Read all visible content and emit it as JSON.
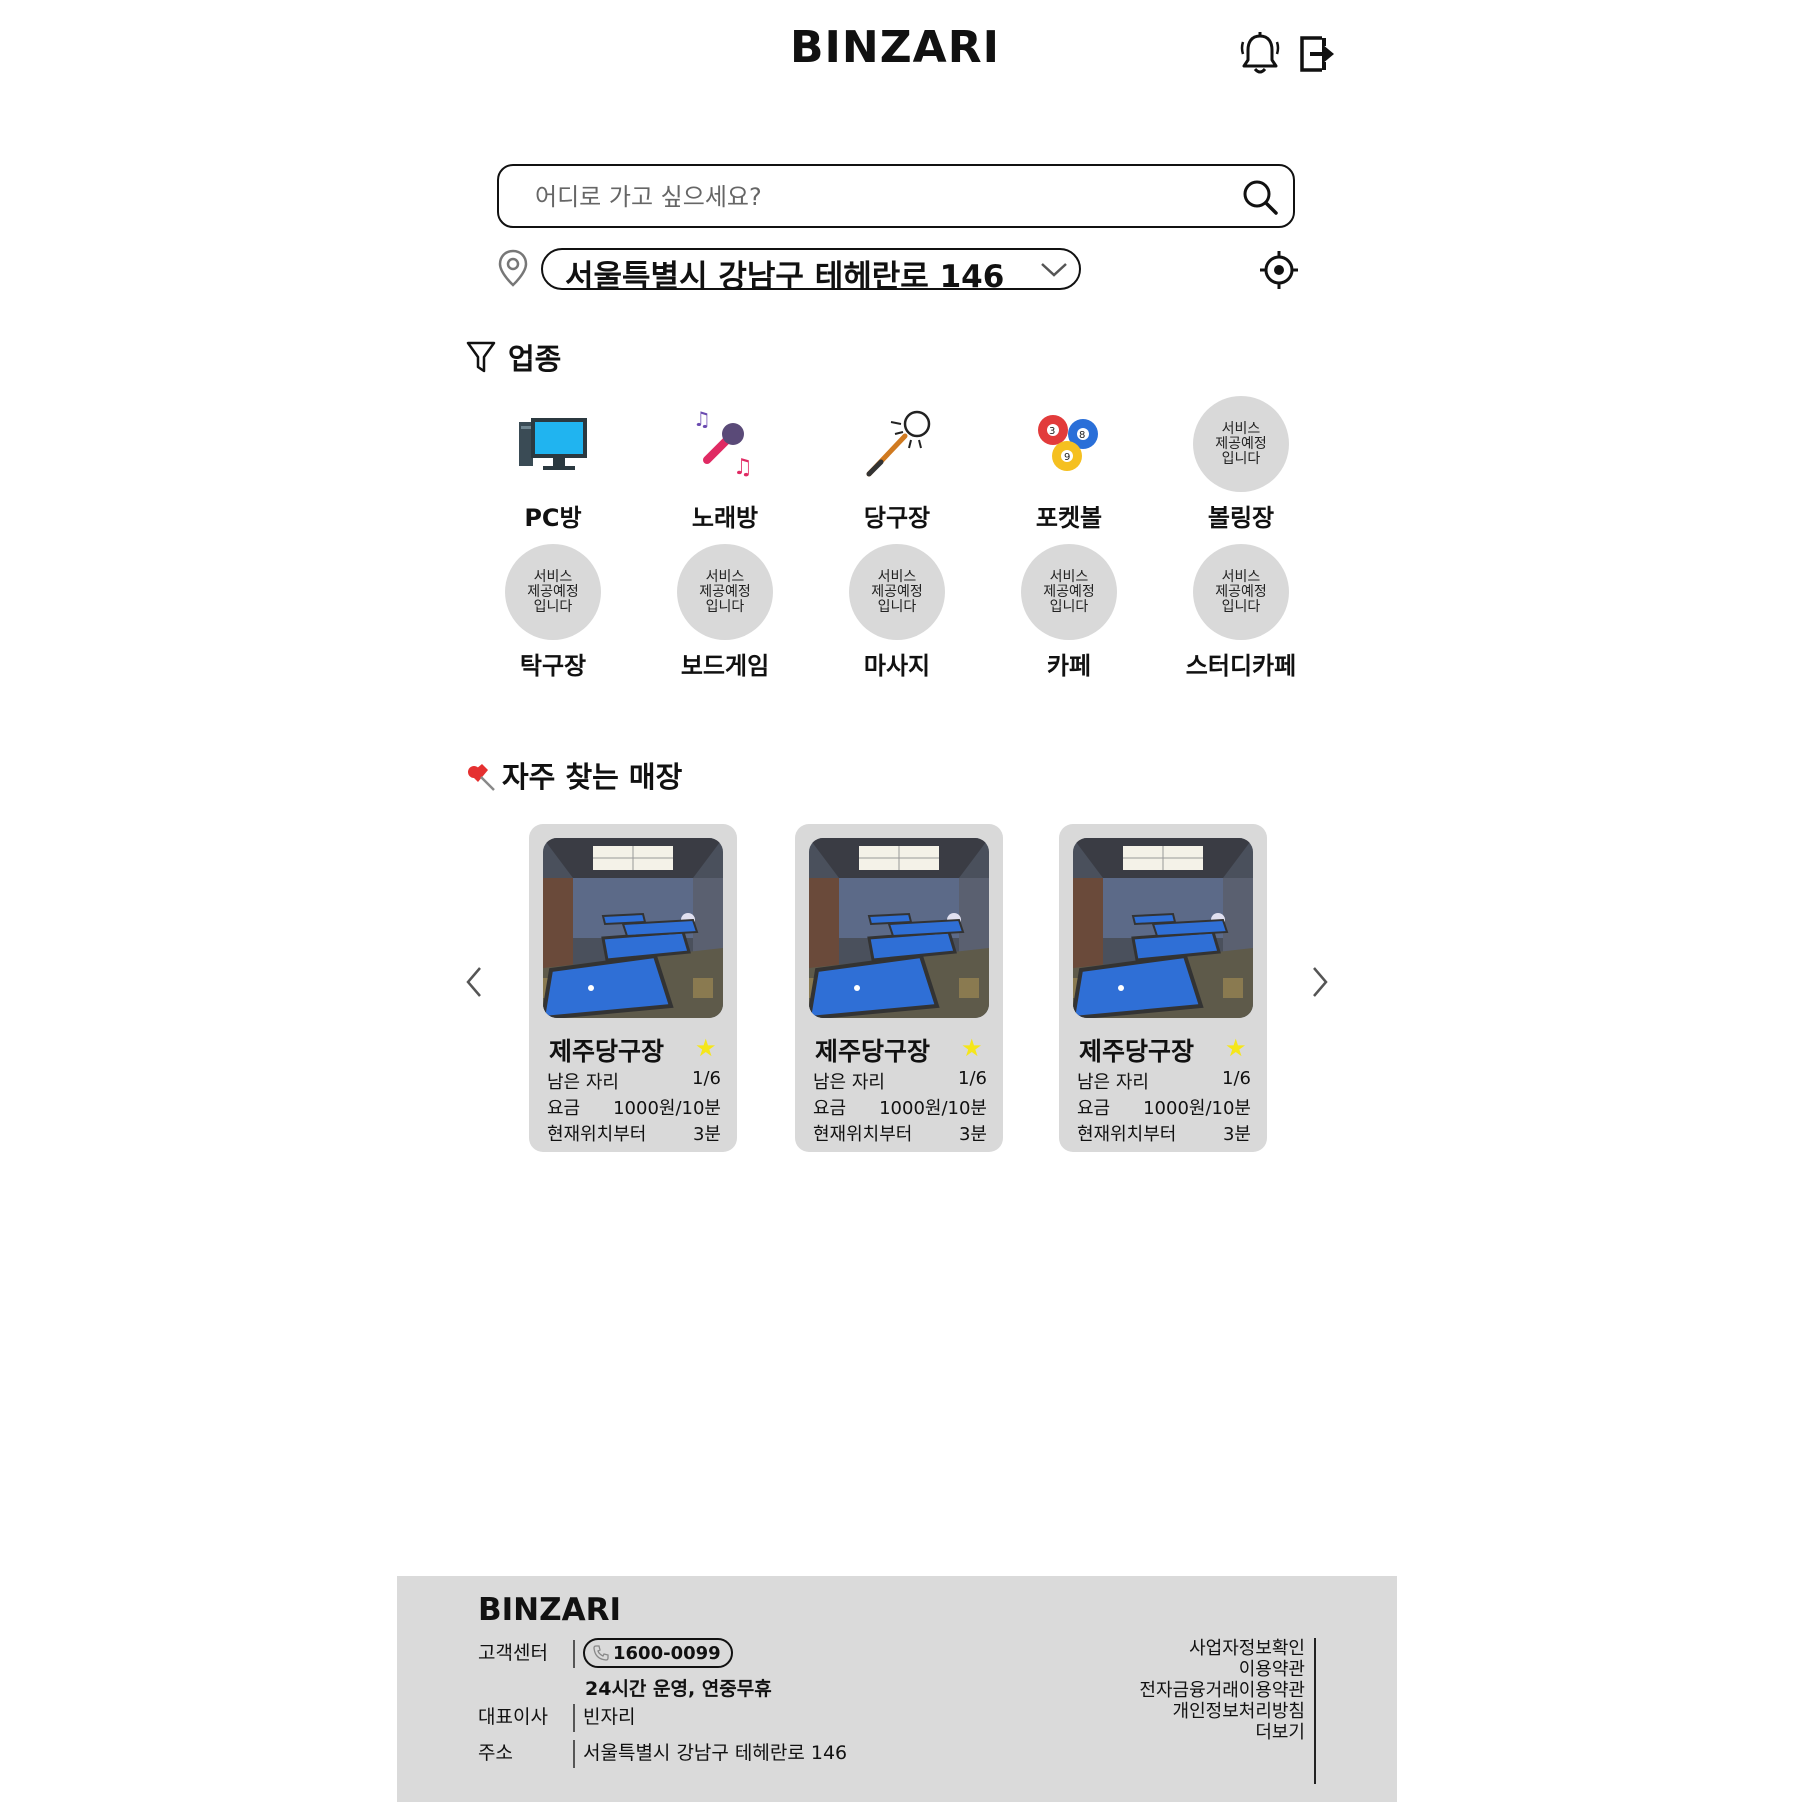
{
  "header": {
    "title": "BINZARI"
  },
  "search": {
    "placeholder": "어디로 가고 싶으세요?",
    "value": ""
  },
  "location": {
    "address": "서울특별시 강남구 테헤란로 146"
  },
  "categories_section": {
    "title": "업종",
    "items": [
      {
        "label": "PC방",
        "icon": "pc-icon"
      },
      {
        "label": "노래방",
        "icon": "microphone-icon"
      },
      {
        "label": "당구장",
        "icon": "billiard-cue-icon"
      },
      {
        "label": "포켓볼",
        "icon": "pool-balls-icon"
      },
      {
        "label": "볼링장",
        "coming_soon": "서비스\n제공예정\n입니다"
      },
      {
        "label": "탁구장",
        "coming_soon": "서비스\n제공예정\n입니다"
      },
      {
        "label": "보드게임",
        "coming_soon": "서비스\n제공예정\n입니다"
      },
      {
        "label": "마사지",
        "coming_soon": "서비스\n제공예정\n입니다"
      },
      {
        "label": "카페",
        "coming_soon": "서비스\n제공예정\n입니다"
      },
      {
        "label": "스터디카페",
        "coming_soon": "서비스\n제공예정\n입니다"
      }
    ]
  },
  "frequent_section": {
    "title": "자주 찾는 매장",
    "stores": [
      {
        "name": "제주당구장",
        "seats_label": "남은 자리",
        "seats": "1/6",
        "price_label": "요금",
        "price": "1000원/10분",
        "distance_label": "현재위치부터",
        "distance": "3분"
      },
      {
        "name": "제주당구장",
        "seats_label": "남은 자리",
        "seats": "1/6",
        "price_label": "요금",
        "price": "1000원/10분",
        "distance_label": "현재위치부터",
        "distance": "3분"
      },
      {
        "name": "제주당구장",
        "seats_label": "남은 자리",
        "seats": "1/6",
        "price_label": "요금",
        "price": "1000원/10분",
        "distance_label": "현재위치부터",
        "distance": "3분"
      }
    ]
  },
  "footer": {
    "brand": "BINZARI",
    "cs_label": "고객센터",
    "phone": "1600-0099",
    "hours": "24시간 운영, 연중무휴",
    "ceo_label": "대표이사",
    "ceo": "빈자리",
    "address_label": "주소",
    "address": "서울특별시 강남구 테헤란로 146",
    "links": [
      "사업자정보확인",
      "이용약관",
      "전자금융거래이용약관",
      "개인정보처리방침",
      "더보기"
    ]
  },
  "colors": {
    "card_bg": "#d9d9d9",
    "footer_bg": "#dadada",
    "star": "#f5e61a",
    "pool_felt": "#2f6fd6"
  }
}
